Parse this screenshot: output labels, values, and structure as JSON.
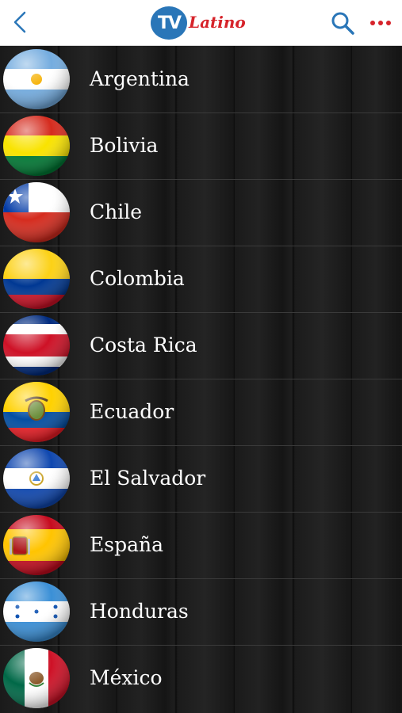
{
  "header": {
    "logo_badge": "TV",
    "logo_word": "Latino"
  },
  "colors": {
    "brand_blue": "#2a76b8",
    "brand_red": "#d6232a",
    "icon_blue": "#2a76b8"
  },
  "icons": {
    "back": "chevron-left-icon",
    "search": "search-icon",
    "more": "more-horizontal-icon"
  },
  "countries": [
    {
      "name": "Argentina",
      "flag": "argentina-flag-icon"
    },
    {
      "name": "Bolivia",
      "flag": "bolivia-flag-icon"
    },
    {
      "name": "Chile",
      "flag": "chile-flag-icon"
    },
    {
      "name": "Colombia",
      "flag": "colombia-flag-icon"
    },
    {
      "name": "Costa Rica",
      "flag": "costa-rica-flag-icon"
    },
    {
      "name": "Ecuador",
      "flag": "ecuador-flag-icon"
    },
    {
      "name": "El Salvador",
      "flag": "el-salvador-flag-icon"
    },
    {
      "name": "España",
      "flag": "spain-flag-icon"
    },
    {
      "name": "Honduras",
      "flag": "honduras-flag-icon"
    },
    {
      "name": "México",
      "flag": "mexico-flag-icon"
    }
  ]
}
